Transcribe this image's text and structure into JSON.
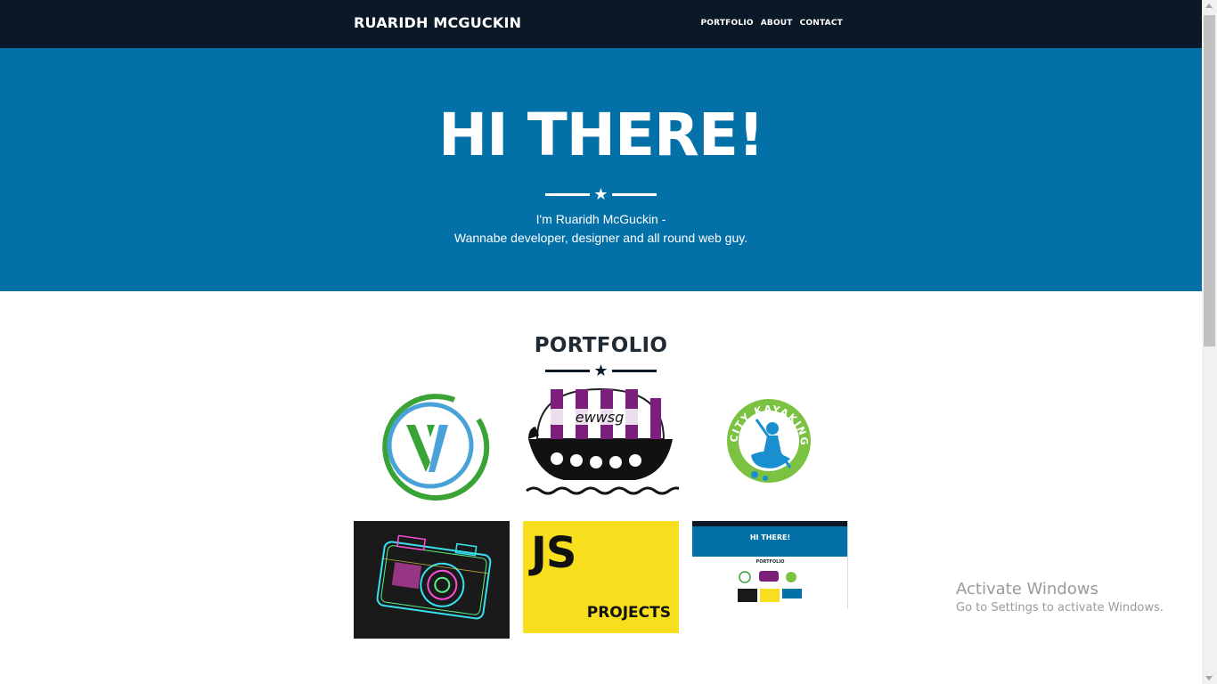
{
  "navbar": {
    "brand": "RUARIDH MCGUCKIN",
    "links": [
      "PORTFOLIO",
      "ABOUT",
      "CONTACT"
    ]
  },
  "hero": {
    "title": "HI THERE!",
    "subtitle_line1": "I'm Ruaridh McGuckin -",
    "subtitle_line2": "Wannabe developer, designer and all round web guy."
  },
  "portfolio": {
    "title": "PORTFOLIO",
    "items": [
      {
        "name": "V logo",
        "logo_text": "V"
      },
      {
        "name": "EWWSG longboat",
        "logo_text": "ewwsg"
      },
      {
        "name": "City Kayaking",
        "logo_text": "CITY KAYAKING"
      },
      {
        "name": "Neon camera",
        "logo_text": ""
      },
      {
        "name": "JS Projects",
        "logo_text": "JS",
        "caption": "PROJECTS"
      },
      {
        "name": "Portfolio site preview",
        "logo_text": "HI THERE!",
        "caption": "PORTFOLIO"
      }
    ]
  },
  "watermark": {
    "title": "Activate Windows",
    "subtitle": "Go to Settings to activate Windows."
  },
  "colors": {
    "navbar_bg": "#0a1828",
    "hero_bg": "#0470a8",
    "accent_green": "#3aa335",
    "accent_blue": "#4aa3d8",
    "purple": "#7a1f7a",
    "js_yellow": "#f7df1e"
  }
}
